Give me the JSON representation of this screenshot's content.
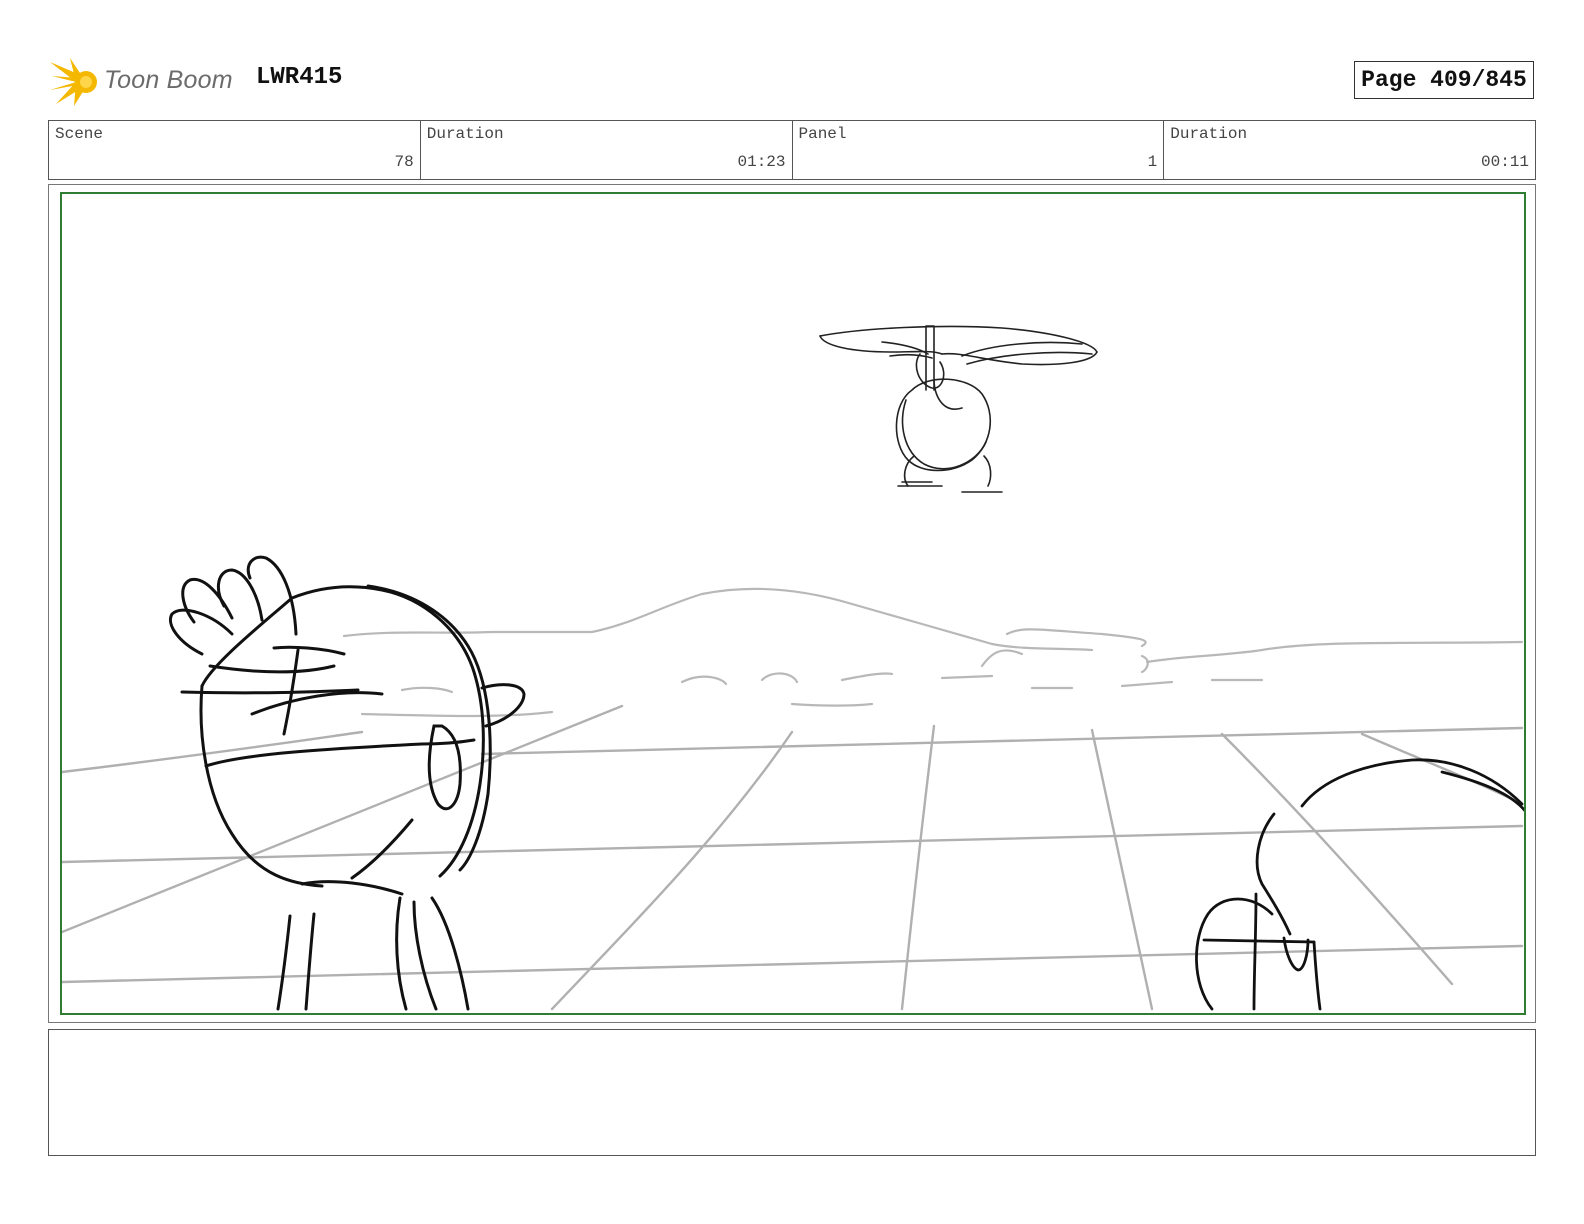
{
  "header": {
    "logo_text": "Toon Boom",
    "project_code": "LWR415",
    "page_label": "Page 409/845"
  },
  "info": {
    "scene_label": "Scene",
    "scene_value": "78",
    "scene_duration_label": "Duration",
    "scene_duration_value": "01:23",
    "panel_label": "Panel",
    "panel_value": "1",
    "panel_duration_label": "Duration",
    "panel_duration_value": "00:11"
  },
  "colors": {
    "frame_border": "#2e7d32",
    "logo_accent": "#f5b800",
    "sketch_dark": "#111111",
    "sketch_light": "#b0b0b0"
  },
  "notes": {
    "text": ""
  }
}
